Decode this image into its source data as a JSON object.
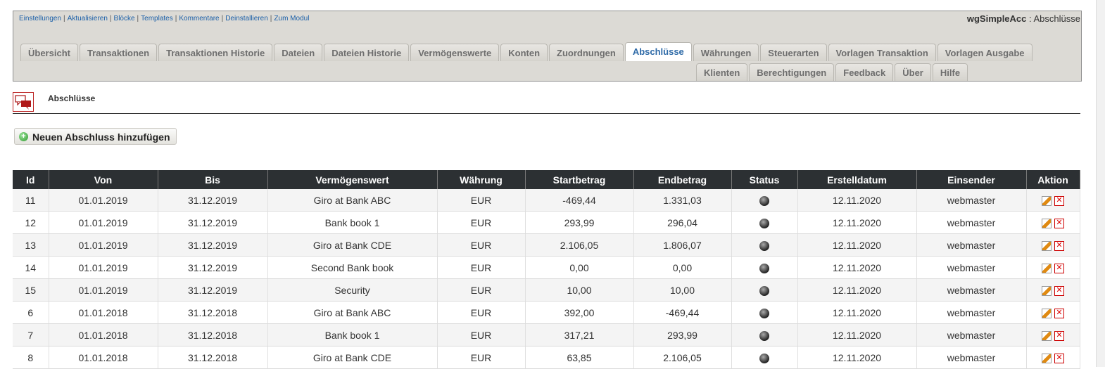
{
  "toplinks": [
    "Einstellungen",
    "Aktualisieren",
    "Blöcke",
    "Templates",
    "Kommentare",
    "Deinstallieren",
    "Zum Modul"
  ],
  "module": {
    "name": "wgSimpleAcc",
    "page": "Abschlüsse"
  },
  "tabs_row1": [
    "Übersicht",
    "Transaktionen",
    "Transaktionen Historie",
    "Dateien",
    "Dateien Historie",
    "Vermögenswerte",
    "Konten",
    "Zuordnungen",
    "Abschlüsse",
    "Währungen",
    "Steuerarten",
    "Vorlagen Transaktion",
    "Vorlagen Ausgabe"
  ],
  "tabs_row2": [
    "Klienten",
    "Berechtigungen",
    "Feedback",
    "Über",
    "Hilfe"
  ],
  "active_tab": "Abschlüsse",
  "section": {
    "title": "Abschlüsse",
    "icon": "comments-icon"
  },
  "add_button": {
    "label": "Neuen Abschluss hinzufügen",
    "icon": "add-icon"
  },
  "table": {
    "columns": [
      "Id",
      "Von",
      "Bis",
      "Vermögenswert",
      "Währung",
      "Startbetrag",
      "Endbetrag",
      "Status",
      "Erstelldatum",
      "Einsender",
      "Aktion"
    ],
    "rows": [
      [
        "11",
        "01.01.2019",
        "31.12.2019",
        "Giro at Bank ABC",
        "EUR",
        "-469,44",
        "1.331,03",
        "12.11.2020",
        "webmaster"
      ],
      [
        "12",
        "01.01.2019",
        "31.12.2019",
        "Bank book 1",
        "EUR",
        "293,99",
        "296,04",
        "12.11.2020",
        "webmaster"
      ],
      [
        "13",
        "01.01.2019",
        "31.12.2019",
        "Giro at Bank CDE",
        "EUR",
        "2.106,05",
        "1.806,07",
        "12.11.2020",
        "webmaster"
      ],
      [
        "14",
        "01.01.2019",
        "31.12.2019",
        "Second Bank book",
        "EUR",
        "0,00",
        "0,00",
        "12.11.2020",
        "webmaster"
      ],
      [
        "15",
        "01.01.2019",
        "31.12.2019",
        "Security",
        "EUR",
        "10,00",
        "10,00",
        "12.11.2020",
        "webmaster"
      ],
      [
        "6",
        "01.01.2018",
        "31.12.2018",
        "Giro at Bank ABC",
        "EUR",
        "392,00",
        "-469,44",
        "12.11.2020",
        "webmaster"
      ],
      [
        "7",
        "01.01.2018",
        "31.12.2018",
        "Bank book 1",
        "EUR",
        "317,21",
        "293,99",
        "12.11.2020",
        "webmaster"
      ],
      [
        "8",
        "01.01.2018",
        "31.12.2018",
        "Giro at Bank CDE",
        "EUR",
        "63,85",
        "2.106,05",
        "12.11.2020",
        "webmaster"
      ]
    ]
  },
  "icons": {
    "status": "globe-icon",
    "edit": "edit-icon",
    "delete": "delete-icon"
  }
}
